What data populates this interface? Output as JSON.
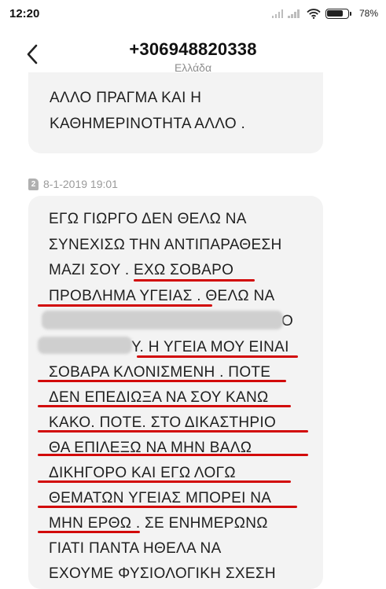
{
  "status_bar": {
    "time": "12:20",
    "battery_percent": "78%",
    "battery_level": 0.78,
    "icons": [
      "signal-icon",
      "signal-icon",
      "wifi-icon",
      "battery-icon"
    ]
  },
  "header": {
    "back_icon": "chevron-left-icon",
    "title": "+306948820338",
    "subtitle": "Ελλάδα"
  },
  "messages": [
    {
      "lines": [
        "ΑΛΛΟ ΠΡΑΓΜΑ ΚΑΙ Η",
        "ΚΑΘΗΜΕΡΙΝΟΤΗΤΑ ΑΛΛΟ ."
      ]
    },
    {
      "sim": "2",
      "timestamp": "8-1-2019 19:01",
      "lines": [
        "ΕΓΩ ΓΙΩΡΓΟ ΔΕΝ ΘΕΛΩ ΝΑ",
        "ΣΥΝΕΧΙΣΩ ΤΗΝ ΑΝΤΙΠΑΡΑΘΕΣΗ",
        "ΜΑΖΙ ΣΟΥ . ΕΧΩ ΣΟΒΑΡΟ",
        "ΠΡΟΒΛΗΜΑ ΥΓΕΙΑΣ . ΘΕΛΩ ΝΑ",
        "Ο",
        "Υ. Η ΥΓΕΙΑ ΜΟΥ ΕΙΝΑΙ",
        "ΣΟΒΑΡΑ ΚΛΟΝΙΣΜΕΝΗ . ΠΟΤΕ",
        "ΔΕΝ ΕΠΕΔΙΩΞΑ ΝΑ ΣΟΥ ΚΑΝΩ",
        "ΚΑΚΟ. ΠΟΤΕ. ΣΤΟ ΔΙΚΑΣΤΗΡΙΟ",
        "ΘΑ ΕΠΙΛΕΞΩ ΝΑ ΜΗΝ ΒΑΛΩ",
        "ΔΙΚΗΓΟΡΟ ΚΑΙ ΕΓΩ ΛΟΓΩ",
        "ΘΕΜΑΤΩΝ ΥΓΕΙΑΣ ΜΠΟΡΕΙ ΝΑ",
        "ΜΗΝ ΕΡΘΩ . ΣΕ ΕΝΗΜΕΡΩΝΩ",
        "ΓΙΑΤΙ ΠΑΝΤΑ ΗΘΕΛΑ ΝΑ",
        "ΕΧΟΥΜΕ ΦΥΣΙΟΛΟΓΙΚΗ ΣΧΕΣΗ"
      ]
    }
  ]
}
